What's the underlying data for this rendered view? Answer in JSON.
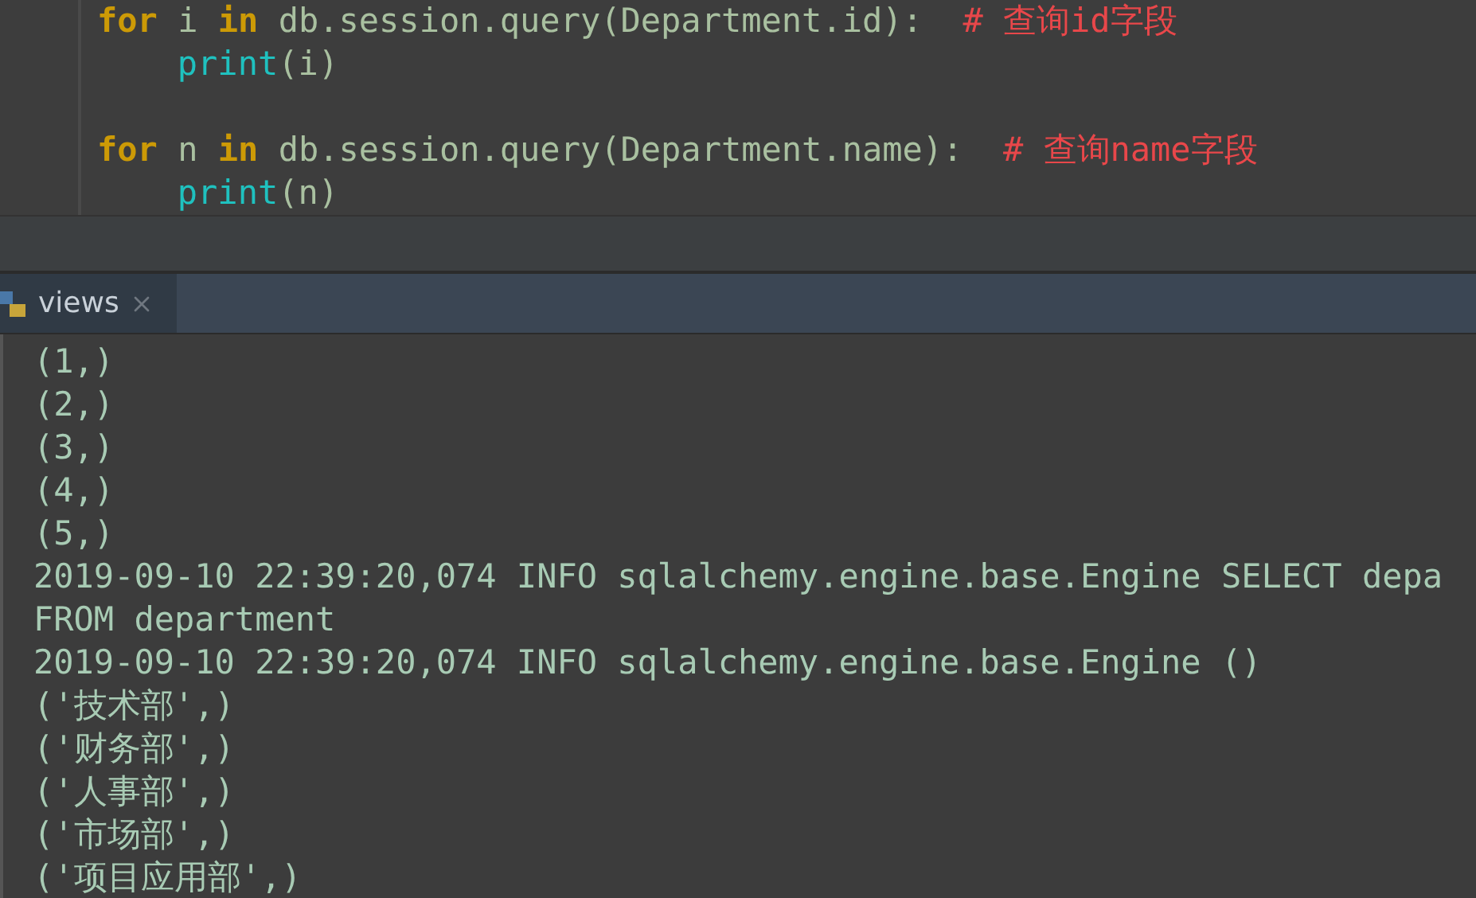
{
  "editor": {
    "lines": [
      {
        "kind": "code",
        "indented": false,
        "tokens": [
          {
            "kind": "keyword",
            "text": "for"
          },
          {
            "kind": "plain",
            "text": " i "
          },
          {
            "kind": "keyword",
            "text": "in"
          },
          {
            "kind": "plain",
            "text": " db.session.query(Department.id):  "
          },
          {
            "kind": "comment",
            "text": "# 查询id字段"
          }
        ]
      },
      {
        "kind": "code",
        "indented": true,
        "tokens": [
          {
            "kind": "builtin",
            "text": "print"
          },
          {
            "kind": "plain",
            "text": "(i)"
          }
        ]
      },
      {
        "kind": "blank"
      },
      {
        "kind": "code",
        "indented": false,
        "tokens": [
          {
            "kind": "keyword",
            "text": "for"
          },
          {
            "kind": "plain",
            "text": " n "
          },
          {
            "kind": "keyword",
            "text": "in"
          },
          {
            "kind": "plain",
            "text": " db.session.query(Department.name):  "
          },
          {
            "kind": "comment",
            "text": "# 查询name字段"
          }
        ]
      },
      {
        "kind": "code",
        "indented": true,
        "tokens": [
          {
            "kind": "builtin",
            "text": "print"
          },
          {
            "kind": "plain",
            "text": "(n)"
          }
        ]
      }
    ]
  },
  "run_tab": {
    "label": "views",
    "selected": true
  },
  "console": {
    "lines": [
      "(1,)",
      "(2,)",
      "(3,)",
      "(4,)",
      "(5,)",
      "2019-09-10 22:39:20,074 INFO sqlalchemy.engine.base.Engine SELECT depa",
      "FROM department",
      "2019-09-10 22:39:20,074 INFO sqlalchemy.engine.base.Engine ()",
      "('技术部',)",
      "('财务部',)",
      "('人事部',)",
      "('市场部',)",
      "('项目应用部',)"
    ]
  }
}
